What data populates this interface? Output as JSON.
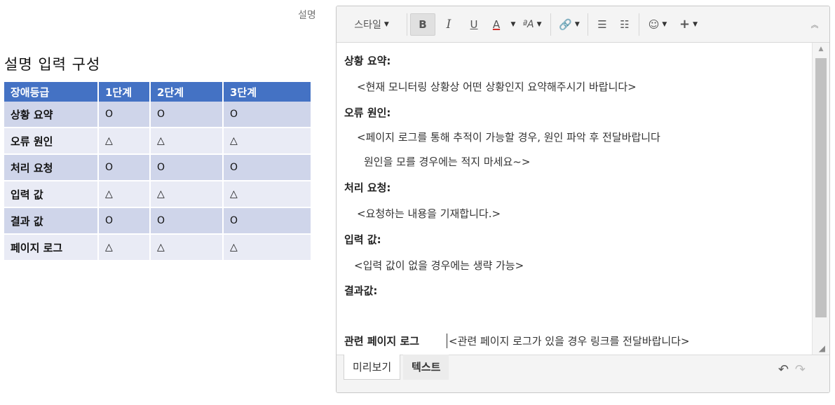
{
  "left": {
    "title": "설명 입력 구성",
    "table": {
      "headers": [
        "장애등급",
        "1단계",
        "2단계",
        "3단계"
      ],
      "rows": [
        {
          "label": "상황 요약",
          "cells": [
            "O",
            "O",
            "O"
          ]
        },
        {
          "label": "오류 원인",
          "cells": [
            "△",
            "△",
            "△"
          ]
        },
        {
          "label": "처리 요청",
          "cells": [
            "O",
            "O",
            "O"
          ]
        },
        {
          "label": "입력 값",
          "cells": [
            "△",
            "△",
            "△"
          ]
        },
        {
          "label": "결과 값",
          "cells": [
            "O",
            "O",
            "O"
          ]
        },
        {
          "label": "페이지 로그",
          "cells": [
            "△",
            "△",
            "△"
          ]
        }
      ]
    }
  },
  "field_label": "설명",
  "editor": {
    "toolbar": {
      "style_label": "스타일",
      "bold": "B",
      "italic": "I",
      "underline": "U",
      "text_color": "A",
      "font_size": "ªA"
    },
    "content": {
      "h1": "상황 요약:",
      "p1": "<현재 모니터링 상황상 어떤 상황인지 요약해주시기 바랍니다>",
      "h2": "오류 원인:",
      "p2a": "<페이지 로그를 통해 추적이 가능할 경우, 원인 파악 후 전달바랍니다",
      "p2b": "원인을 모를 경우에는 적지 마세요~>",
      "h3": "처리 요청:",
      "p3": "<요청하는 내용을 기재합니다.>",
      "h4": "입력 값:",
      "p4": "<입력 값이 없을 경우에는 생략 가능>",
      "h5": "결과값:",
      "h6": "관련 페이지 로그",
      "p6": "<관련 페이지 로그가 있을 경우 링크를 전달바랍니다>"
    },
    "tabs": {
      "preview": "미리보기",
      "text": "텍스트"
    }
  }
}
